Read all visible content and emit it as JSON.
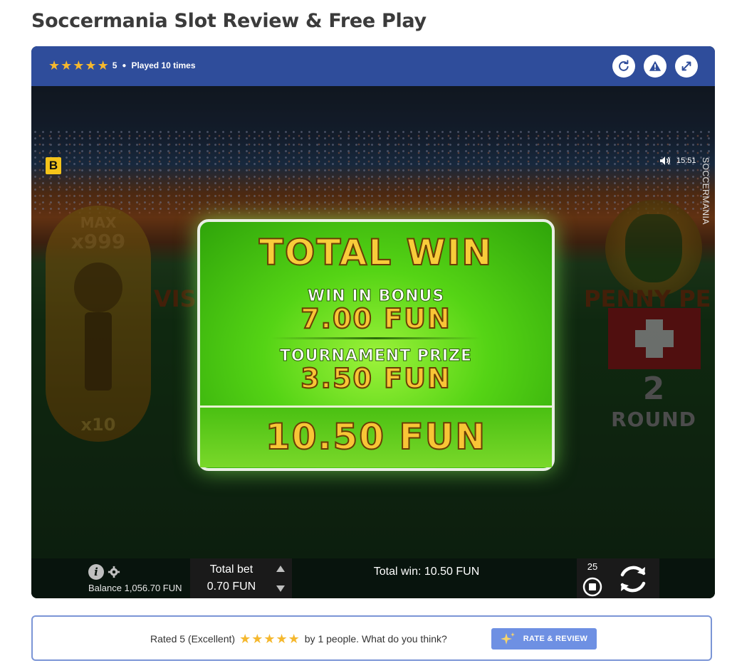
{
  "page": {
    "title": "Soccermania Slot Review & Free Play"
  },
  "header": {
    "rating_value": "5",
    "played_text": "Played 10 times",
    "buttons": {
      "reload": "reload-icon",
      "report": "warning-icon",
      "fullscreen": "expand-icon"
    }
  },
  "game": {
    "brand_logo": "B",
    "clock": "15:51",
    "vertical_title": "SOCCERMANIA",
    "left_panel": {
      "max_label": "MAX",
      "max_multiplier": "x999",
      "min_multiplier": "x10",
      "side_text": "VIS"
    },
    "right_panel": {
      "side_text": "PENNY PE",
      "round_number": "2",
      "round_label": "ROUND"
    },
    "win_panel": {
      "title": "TOTAL WIN",
      "bonus_label": "WIN IN BONUS",
      "bonus_value": "7.00 FUN",
      "tournament_label": "TOURNAMENT PRIZE",
      "tournament_value": "3.50 FUN",
      "total_value": "10.50 FUN"
    },
    "bottom_bar": {
      "balance_text": "Balance 1,056.70 FUN",
      "total_bet_label": "Total bet",
      "total_bet_value": "0.70 FUN",
      "total_win_text": "Total win: 10.50 FUN",
      "autoplay_count": "25"
    }
  },
  "rating_box": {
    "prefix": "Rated 5 (Excellent)",
    "suffix": "by 1 people. What do you think?",
    "button_label": "RATE & REVIEW"
  },
  "colors": {
    "header_bg": "#2f4d9b",
    "star": "#f5b82e",
    "button": "#6e90e3",
    "win_gold": "#f8c536",
    "win_green": "#55d415"
  }
}
